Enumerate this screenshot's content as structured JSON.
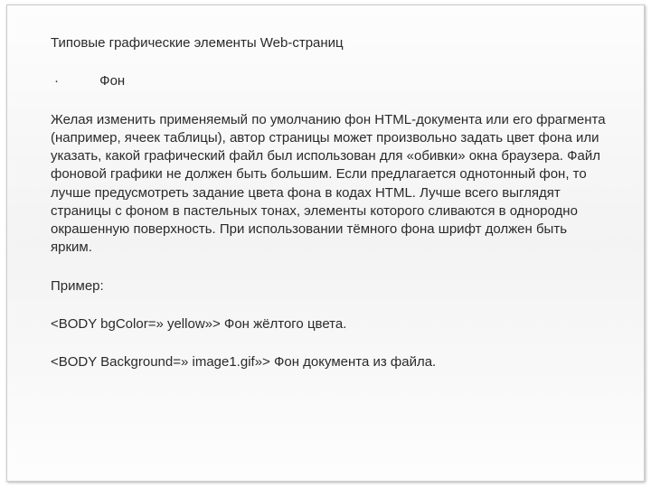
{
  "title": "Типовые графические элементы Web-страниц",
  "bullet": {
    "symbol": "·",
    "label": "Фон"
  },
  "paragraph": "Желая изменить применяемый по умолчанию фон HTML-документа или его фрагмента (например, ячеек таблицы), автор страницы может произвольно задать цвет фона или указать, какой графический файл был использован для «обивки» окна браузера. Файл фоновой графики не должен быть большим. Если предлагается однотонный фон, то лучше предусмотреть задание цвета фона в кодах HTML. Лучше всего выглядят страницы с фоном в пастельных тонах, элементы которого сливаются в однородно окрашенную поверхность. При использовании тёмного фона шрифт должен быть ярким.",
  "example_label": "Пример:",
  "code_lines": [
    "<BODY bgColor=» yellow»> Фон жёлтого цвета.",
    "<BODY Background=» image1.gif»> Фон документа из файла."
  ]
}
